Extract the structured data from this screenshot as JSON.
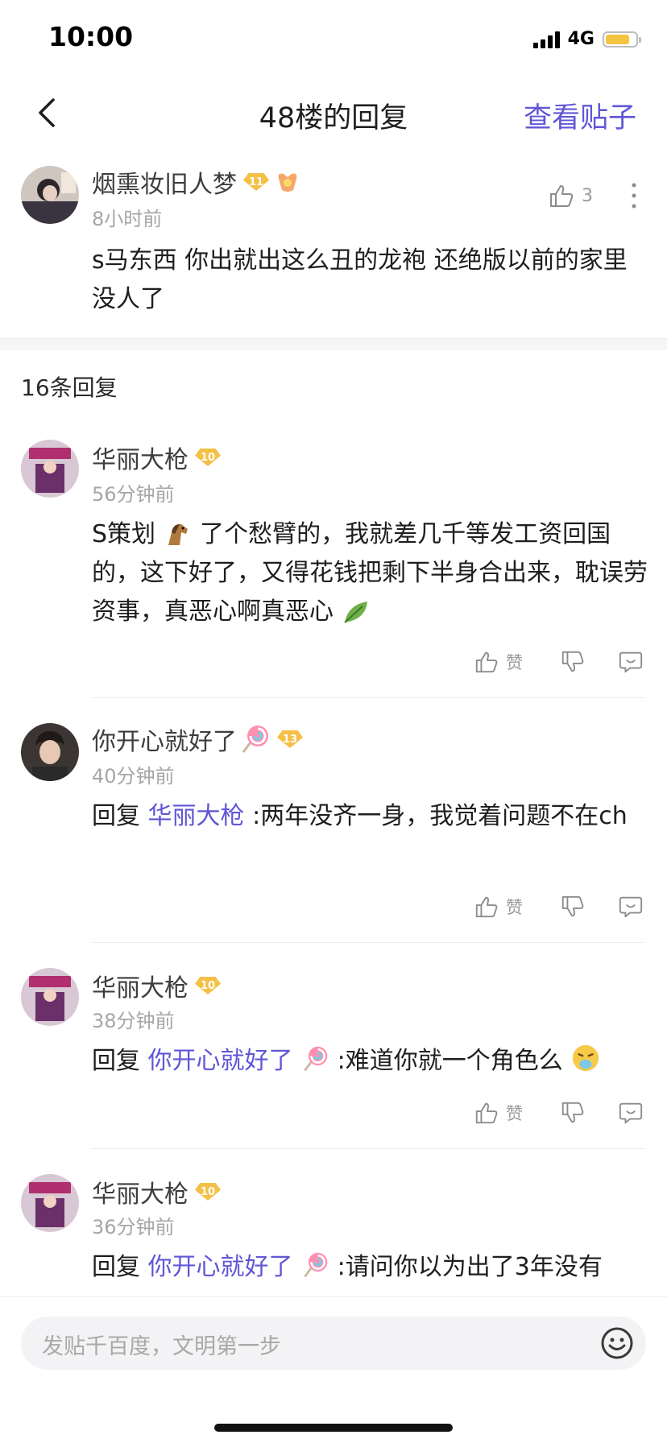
{
  "status_bar": {
    "time": "10:00",
    "network": "4G",
    "battery_level": 0.8
  },
  "nav": {
    "title": "48楼的回复",
    "view_post": "查看贴子"
  },
  "main_post": {
    "username": "烟熏妆旧人梦",
    "level": "11",
    "time": "8小时前",
    "like_count": "3",
    "content": "s马东西 你出就出这么丑的龙袍 还绝版以前的家里没人了"
  },
  "replies_header": "16条回复",
  "replies": [
    {
      "username": "华丽大枪",
      "level": "10",
      "time": "56分钟前",
      "content_a": "S策划",
      "content_b": "了个愁臂的，我就差几千等发工资回国的，这下好了，又得花钱把剩下半身合出来，耽误劳资事，真恶心啊真恶心",
      "like_label": "赞"
    },
    {
      "username": "你开心就好了",
      "level": "13",
      "time": "40分钟前",
      "reply_prefix": "回复",
      "reply_to": "华丽大枪",
      "content": ":两年没齐一身，我觉着问题不在ch",
      "like_label": "赞"
    },
    {
      "username": "华丽大枪",
      "level": "10",
      "time": "38分钟前",
      "reply_prefix": "回复",
      "reply_to": "你开心就好了",
      "content": ":难道你就一个角色么",
      "like_label": "赞"
    },
    {
      "username": "华丽大枪",
      "level": "10",
      "time": "36分钟前",
      "reply_prefix": "回复",
      "reply_to": "你开心就好了",
      "content": ":请问你以为出了3年没有"
    }
  ],
  "input": {
    "placeholder": "发贴千百度，文明第一步"
  },
  "colors": {
    "accent": "#6156d6",
    "badge": "#f4c046",
    "muted": "#a6a6a6"
  }
}
